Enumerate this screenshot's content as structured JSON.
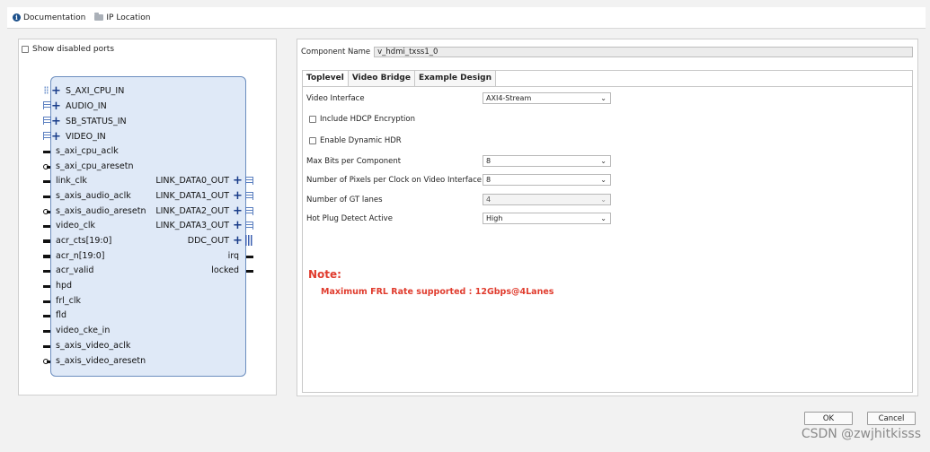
{
  "topbar": {
    "documentation_label": "Documentation",
    "ip_location_label": "IP Location"
  },
  "left_panel": {
    "show_disabled_ports_label": "Show disabled ports",
    "left_ports": [
      "S_AXI_CPU_IN",
      "AUDIO_IN",
      "SB_STATUS_IN",
      "VIDEO_IN",
      "s_axi_cpu_aclk",
      "s_axi_cpu_aresetn",
      "link_clk",
      "s_axis_audio_aclk",
      "s_axis_audio_aresetn",
      "video_clk",
      "acr_cts[19:0]",
      "acr_n[19:0]",
      "acr_valid",
      "hpd",
      "frl_clk",
      "fld",
      "video_cke_in",
      "s_axis_video_aclk",
      "s_axis_video_aresetn"
    ],
    "right_ports": [
      "LINK_DATA0_OUT",
      "LINK_DATA1_OUT",
      "LINK_DATA2_OUT",
      "LINK_DATA3_OUT",
      "DDC_OUT",
      "irq",
      "locked"
    ]
  },
  "right_panel": {
    "component_name_label": "Component Name",
    "component_name_value": "v_hdmi_txss1_0",
    "tabs": [
      "Toplevel",
      "Video Bridge",
      "Example Design"
    ],
    "active_tab": "Toplevel",
    "video_interface_label": "Video Interface",
    "video_interface_value": "AXI4-Stream",
    "include_hdcp_label": "Include HDCP Encryption",
    "enable_dynamic_hdr_label": "Enable Dynamic HDR",
    "max_bits_label": "Max Bits per Component",
    "max_bits_value": "8",
    "pixels_per_clock_label": "Number of Pixels per Clock on Video Interface",
    "pixels_per_clock_value": "8",
    "gt_lanes_label": "Number of GT lanes",
    "gt_lanes_value": "4",
    "hot_plug_label": "Hot Plug Detect Active",
    "hot_plug_value": "High",
    "note_title": "Note:",
    "note_text": "Maximum FRL Rate supported : 12Gbps@4Lanes"
  },
  "buttons": {
    "ok": "OK",
    "cancel": "Cancel"
  },
  "watermark": "CSDN @zwjhitkisss",
  "colors": {
    "note_red": "#e03c2e",
    "ip_block_fill": "#dfe9f7",
    "ip_block_border": "#6d8fbf"
  }
}
